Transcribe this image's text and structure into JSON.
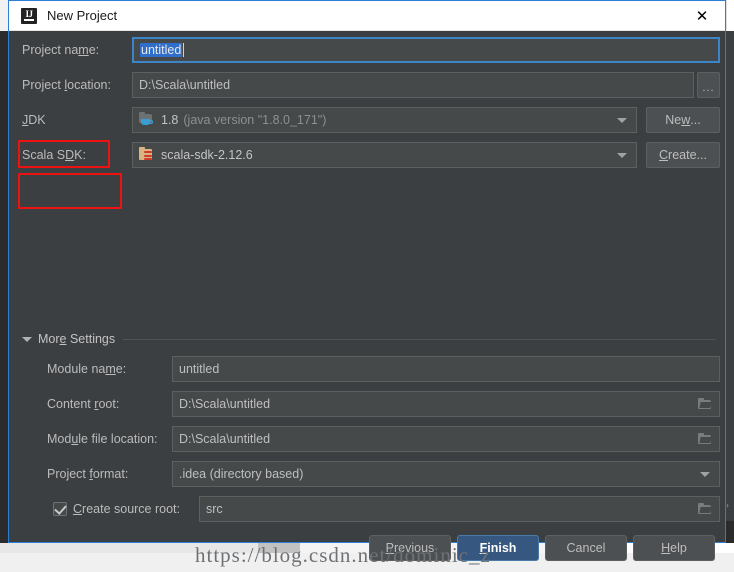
{
  "window": {
    "title": "New Project",
    "app_icon": "intellij-idea-icon",
    "close_label": "✕",
    "accent_border_color": "#2d7fd3",
    "background_color": "#3c3f41"
  },
  "form": {
    "project_name": {
      "label": "Project name:",
      "label_mnemonic": "m",
      "value": "untitled",
      "selected": true
    },
    "project_location": {
      "label": "Project location:",
      "label_mnemonic": "l",
      "value": "D:\\Scala\\untitled",
      "browse_button": "..."
    },
    "jdk": {
      "label": "JDK",
      "label_mnemonic": "J",
      "icon": "jdk-folder-icon",
      "value": "1.8",
      "detail": "(java version \"1.8.0_171\")",
      "action_button": "New...",
      "action_mnemonic": "w",
      "annotated": true,
      "annotation_color": "#ee1111"
    },
    "scala_sdk": {
      "label": "Scala SDK:",
      "label_mnemonic": "D",
      "icon": "scala-sdk-folder-icon",
      "value": "scala-sdk-2.12.6",
      "action_button": "Create...",
      "action_mnemonic": "C",
      "annotated": true,
      "annotation_color": "#ee1111"
    }
  },
  "more_settings": {
    "title": "More Settings",
    "title_mnemonic": "e",
    "expanded": true,
    "fields": [
      {
        "name": "module-name",
        "label": "Module name:",
        "label_mnemonic": "m",
        "value": "untitled",
        "has_browse": false
      },
      {
        "name": "content-root",
        "label": "Content root:",
        "label_mnemonic": "r",
        "value": "D:\\Scala\\untitled",
        "has_browse": true
      },
      {
        "name": "module-file-location",
        "label": "Module file location:",
        "label_mnemonic": "u",
        "value": "D:\\Scala\\untitled",
        "has_browse": true
      },
      {
        "name": "project-format",
        "label": "Project format:",
        "label_mnemonic": "f",
        "value": ".idea (directory based)",
        "has_browse": false,
        "is_dropdown": true
      }
    ],
    "create_source_root": {
      "label": "Create source root:",
      "label_mnemonic": "C",
      "checked": true,
      "value": "src",
      "has_browse": true
    }
  },
  "buttons": {
    "previous": "Previous",
    "previous_mnemonic": "P",
    "finish": "Finish",
    "finish_mnemonic": "F",
    "finish_is_default": true,
    "cancel": "Cancel",
    "help": "Help",
    "help_mnemonic": "H"
  },
  "watermark": {
    "text": "https://blog.csdn.net/dominic_z"
  }
}
